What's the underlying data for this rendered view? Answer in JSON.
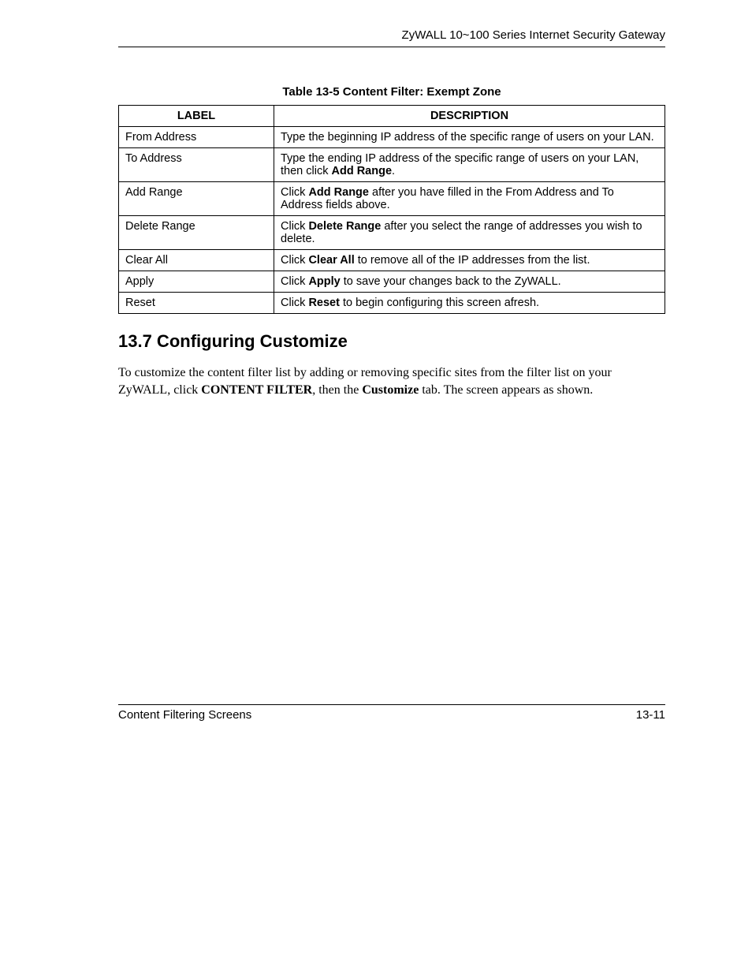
{
  "header": {
    "running_title": "ZyWALL 10~100 Series Internet Security Gateway"
  },
  "table": {
    "caption": "Table 13-5 Content Filter: Exempt Zone",
    "head": {
      "label": "LABEL",
      "desc": "DESCRIPTION"
    },
    "rows": [
      {
        "label": "From Address",
        "desc_pre": "Type the beginning IP address of the specific range of users on your LAN.",
        "bold": "",
        "desc_post": ""
      },
      {
        "label": "To Address",
        "desc_pre": "Type the ending IP address of the specific range of users on your LAN, then click ",
        "bold": "Add Range",
        "desc_post": "."
      },
      {
        "label": "Add Range",
        "desc_pre": "Click ",
        "bold": "Add Range",
        "desc_post": " after you have filled in the From Address and To Address fields above."
      },
      {
        "label": "Delete Range",
        "desc_pre": "Click ",
        "bold": "Delete Range",
        "desc_post": " after you select the range of addresses you wish to delete."
      },
      {
        "label": "Clear All",
        "desc_pre": "Click ",
        "bold": "Clear All",
        "desc_post": " to remove all of the IP addresses from the list."
      },
      {
        "label": "Apply",
        "desc_pre": "Click ",
        "bold": "Apply",
        "desc_post": " to save your changes back to the ZyWALL."
      },
      {
        "label": "Reset",
        "desc_pre": "Click ",
        "bold": "Reset",
        "desc_post": " to begin configuring this screen afresh."
      }
    ]
  },
  "section": {
    "heading": "13.7  Configuring Customize",
    "para_pre": "To customize the content filter list by adding or removing specific sites from the filter list on your ZyWALL, click ",
    "bold1": "CONTENT FILTER",
    "mid": ", then the ",
    "bold2": "Customize",
    "post": " tab. The screen appears as shown."
  },
  "footer": {
    "left": "Content Filtering Screens",
    "right": "13-11"
  }
}
